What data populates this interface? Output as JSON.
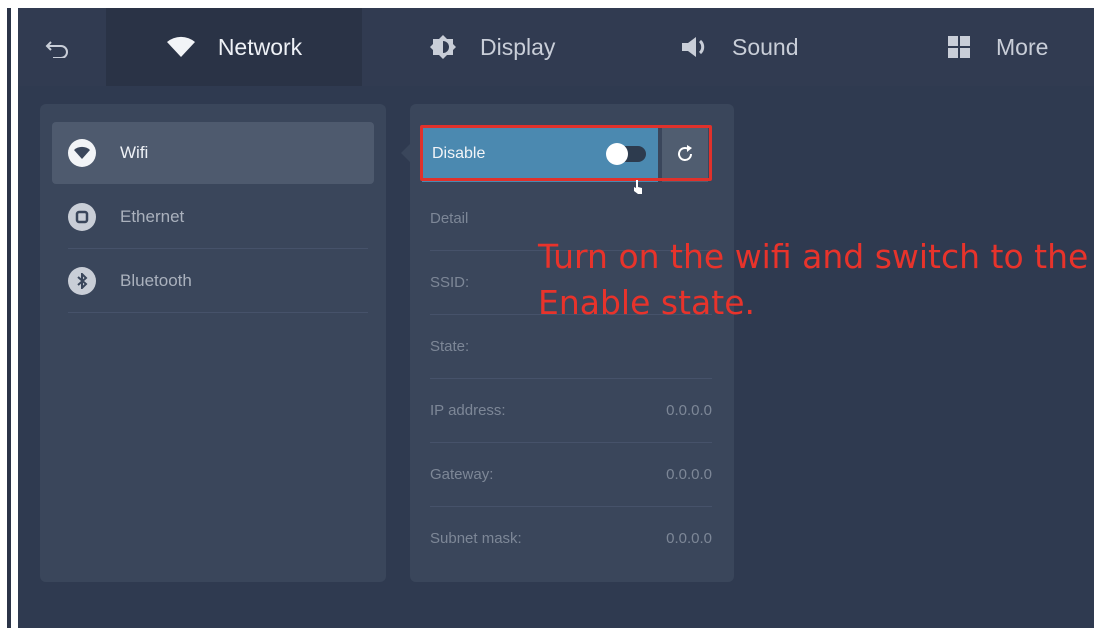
{
  "tabs": [
    {
      "label": "Network",
      "icon": "wifi-icon",
      "active": true
    },
    {
      "label": "Display",
      "icon": "brightness-icon",
      "active": false
    },
    {
      "label": "Sound",
      "icon": "speaker-icon",
      "active": false
    },
    {
      "label": "More",
      "icon": "grid-icon",
      "active": false
    }
  ],
  "menu": {
    "items": [
      {
        "label": "Wifi",
        "icon": "wifi-icon",
        "selected": true
      },
      {
        "label": "Ethernet",
        "icon": "ethernet-icon",
        "selected": false
      },
      {
        "label": "Bluetooth",
        "icon": "bluetooth-icon",
        "selected": false
      }
    ]
  },
  "wifi": {
    "toggle_label": "Disable",
    "enabled": false
  },
  "details": {
    "header": "Detail",
    "rows": [
      {
        "label": "SSID:",
        "value": ""
      },
      {
        "label": "State:",
        "value": ""
      },
      {
        "label": "IP address:",
        "value": "0.0.0.0"
      },
      {
        "label": "Gateway:",
        "value": "0.0.0.0"
      },
      {
        "label": "Subnet mask:",
        "value": "0.0.0.0"
      }
    ]
  },
  "annotation": {
    "text": "Turn on the wifi and switch to the Enable state.",
    "color": "#e8332b"
  },
  "colors": {
    "background": "#2f3a50",
    "panel": "#3a465b",
    "toggle_active": "#4b89b0"
  }
}
